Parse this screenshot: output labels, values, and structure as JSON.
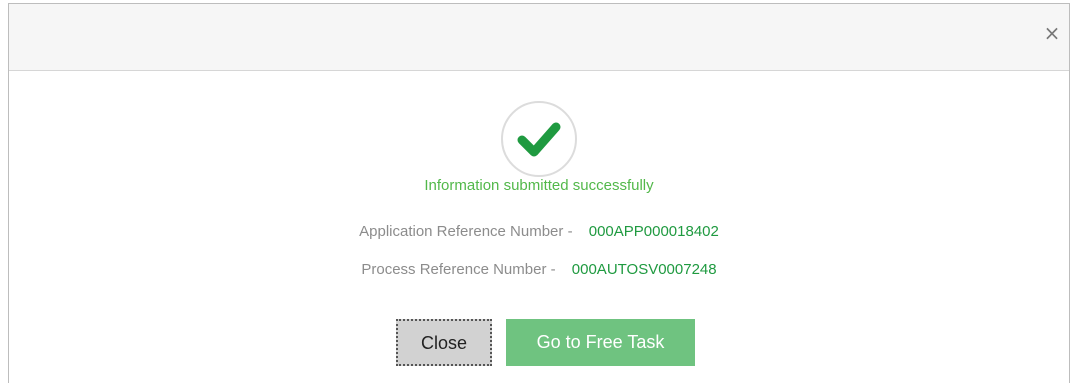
{
  "dialog": {
    "close_icon": "×"
  },
  "status": {
    "icon": "check-icon",
    "message": "Information submitted successfully",
    "color": "#52b84a"
  },
  "references": {
    "application": {
      "label": "Application Reference Number -",
      "value": "000APP000018402"
    },
    "process": {
      "label": "Process Reference Number -",
      "value": "000AUTOSV0007248"
    },
    "value_color": "#1f9a40"
  },
  "buttons": {
    "close_label": "Close",
    "free_task_label": "Go to Free Task",
    "primary_color": "#6fc380"
  }
}
